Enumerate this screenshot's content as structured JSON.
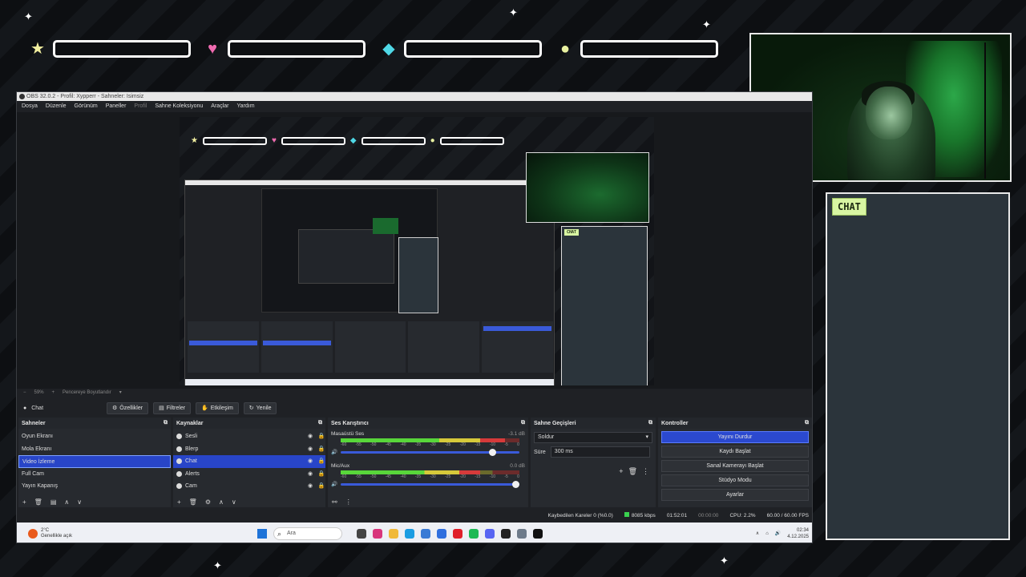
{
  "overlay": {
    "bar_icons": [
      "star-icon",
      "heart-icon",
      "diamond-icon",
      "circle-icon"
    ],
    "bar_colors": [
      "#f3f0a0",
      "#f06bb0",
      "#4fd8e6",
      "#e8f0a0"
    ],
    "chat_badge": "CHAT"
  },
  "obs": {
    "title": "OBS 32.0.2 - Profil: Xypperr - Sahneler: Isimsiz",
    "menu": [
      "Dosya",
      "Düzenle",
      "Görünüm",
      "Paneller",
      "Profil",
      "Sahne Koleksiyonu",
      "Araçlar",
      "Yardım"
    ],
    "zoom": {
      "value": "59%",
      "label": "Pencereye Boyutlandır"
    },
    "toolbar": {
      "source_name": "Chat",
      "properties": "Özellikler",
      "filters": "Filtreler",
      "interact": "Etkileşim",
      "refresh": "Yenile"
    },
    "scenes": {
      "title": "Sahneler",
      "items": [
        "Oyun Ekranı",
        "Mola Ekranı",
        "Video İzleme",
        "Full Cam",
        "Yayın Kapanış"
      ],
      "selected_index": 2
    },
    "sources": {
      "title": "Kaynaklar",
      "items": [
        "Sesli",
        "Blerp",
        "Chat",
        "Alerts",
        "Cam"
      ],
      "selected_index": 2
    },
    "mixer": {
      "title": "Ses Karıştırıcı",
      "tracks": [
        {
          "name": "Masaüstü Ses",
          "db": "-3.1 dB",
          "level": 0.92,
          "volume": 0.85
        },
        {
          "name": "Mic/Aux",
          "db": "0.0 dB",
          "level": 0.78,
          "volume": 0.98
        }
      ],
      "scale": [
        "-60",
        "-55",
        "-50",
        "-45",
        "-40",
        "-35",
        "-30",
        "-25",
        "-20",
        "-15",
        "-10",
        "-5",
        "0"
      ]
    },
    "transitions": {
      "title": "Sahne Geçişleri",
      "selected": "Soldur",
      "duration_label": "Süre",
      "duration_value": "300 ms"
    },
    "controls": {
      "title": "Kontroller",
      "buttons": [
        "Yayını Durdur",
        "Kaydı Başlat",
        "Sanal Kamerayı Başlat",
        "Stüdyo Modu",
        "Ayarlar"
      ]
    },
    "status": {
      "dropped": "Kaybedilen Kareler 0 (%0.0)",
      "bitrate": "8085 kbps",
      "time": "01:52:01",
      "rec_time": "00:00:00",
      "cpu": "CPU: 2.2%",
      "fps": "60.00 / 60.00 FPS"
    },
    "taskbar": {
      "weather_temp": "2°C",
      "weather_desc": "Genellikle açık",
      "search": "Ara",
      "time": "02:34",
      "date": "4.12.2025"
    },
    "mini_chat_badge": "CHAT"
  }
}
